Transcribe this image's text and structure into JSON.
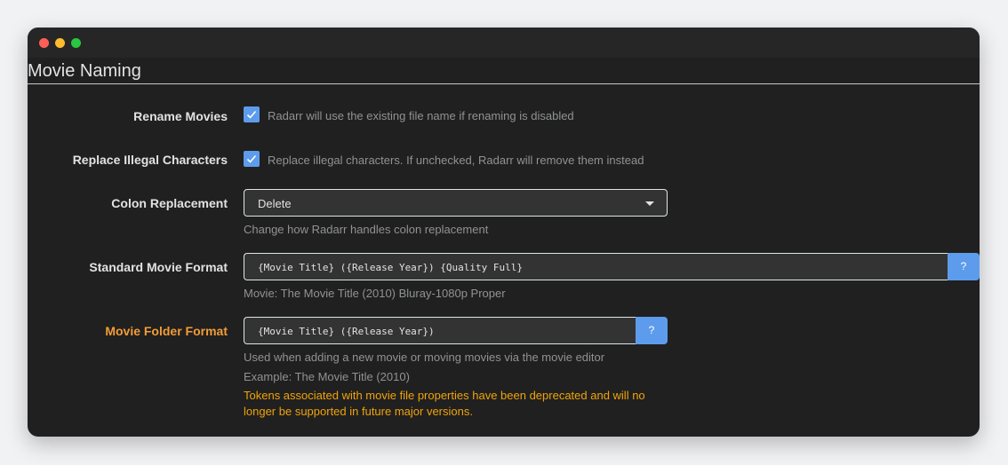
{
  "window": {
    "controls": [
      "close",
      "minimize",
      "maximize"
    ]
  },
  "section_title": "Movie Naming",
  "rename_movies": {
    "label": "Rename Movies",
    "checked": true,
    "help": "Radarr will use the existing file name if renaming is disabled"
  },
  "replace_illegal": {
    "label": "Replace Illegal Characters",
    "checked": true,
    "help": "Replace illegal characters. If unchecked, Radarr will remove them instead"
  },
  "colon_replacement": {
    "label": "Colon Replacement",
    "value": "Delete",
    "help": "Change how Radarr handles colon replacement"
  },
  "standard_format": {
    "label": "Standard Movie Format",
    "value": "{Movie Title} ({Release Year}) {Quality Full}",
    "button": "?",
    "example": "Movie: The Movie Title (2010) Bluray-1080p Proper"
  },
  "folder_format": {
    "label": "Movie Folder Format",
    "value": "{Movie Title} ({Release Year})",
    "button": "?",
    "help": "Used when adding a new movie or moving movies via the movie editor",
    "example": "Example: The Movie Title (2010)",
    "warning": "Tokens associated with movie file properties have been deprecated and will no longer be supported in future major versions."
  },
  "colors": {
    "accent": "#5d9cec",
    "warning": "#f0a30a",
    "background": "#202020"
  }
}
